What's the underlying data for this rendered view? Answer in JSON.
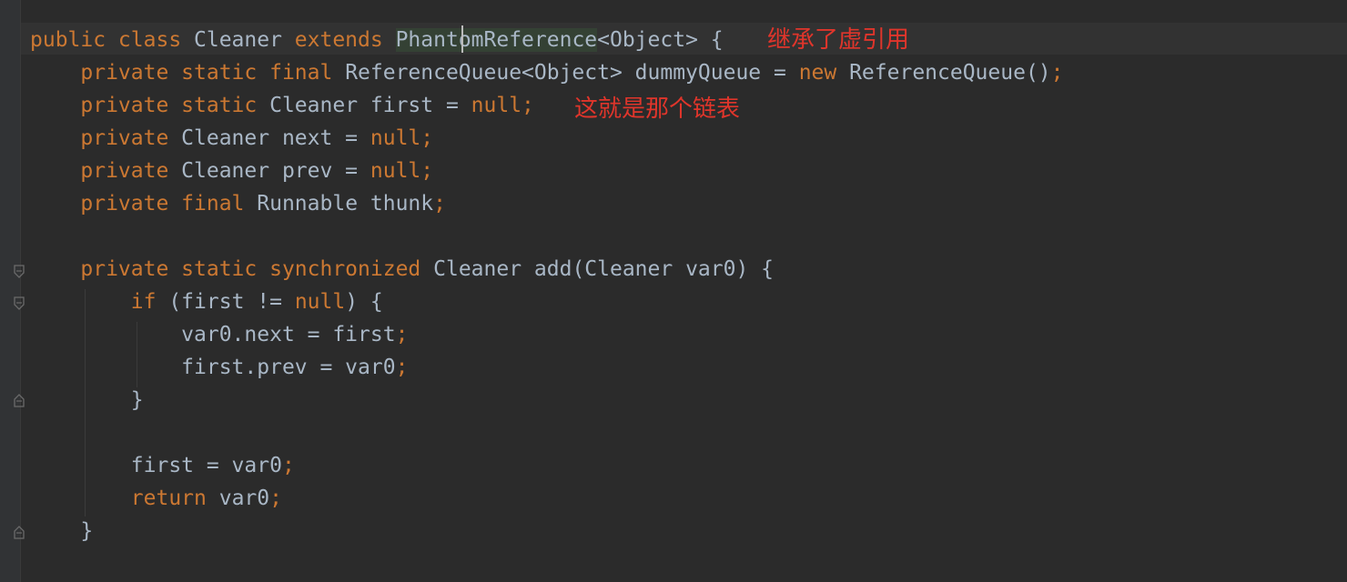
{
  "editor": {
    "lines": [
      [
        {
          "t": "public class ",
          "c": "kw"
        },
        {
          "t": "Cleaner ",
          "c": "pl"
        },
        {
          "t": "extends ",
          "c": "kw"
        },
        {
          "t": "PhantomReference",
          "c": "pl",
          "hl": true
        },
        {
          "t": "<Object> {",
          "c": "pl"
        }
      ],
      [
        {
          "t": "    "
        },
        {
          "t": "private static final ",
          "c": "kw"
        },
        {
          "t": "ReferenceQueue<Object> dummyQueue = ",
          "c": "pl"
        },
        {
          "t": "new ",
          "c": "kw"
        },
        {
          "t": "ReferenceQueue()",
          "c": "pl"
        },
        {
          "t": ";",
          "c": "punc"
        }
      ],
      [
        {
          "t": "    "
        },
        {
          "t": "private static ",
          "c": "kw"
        },
        {
          "t": "Cleaner first = ",
          "c": "pl"
        },
        {
          "t": "null;",
          "c": "kw"
        }
      ],
      [
        {
          "t": "    "
        },
        {
          "t": "private ",
          "c": "kw"
        },
        {
          "t": "Cleaner next = ",
          "c": "pl"
        },
        {
          "t": "null;",
          "c": "kw"
        }
      ],
      [
        {
          "t": "    "
        },
        {
          "t": "private ",
          "c": "kw"
        },
        {
          "t": "Cleaner prev = ",
          "c": "pl"
        },
        {
          "t": "null;",
          "c": "kw"
        }
      ],
      [
        {
          "t": "    "
        },
        {
          "t": "private final ",
          "c": "kw"
        },
        {
          "t": "Runnable thunk",
          "c": "pl"
        },
        {
          "t": ";",
          "c": "punc"
        }
      ],
      [],
      [
        {
          "t": "    "
        },
        {
          "t": "private static synchronized ",
          "c": "kw"
        },
        {
          "t": "Cleaner add(Cleaner var0) {",
          "c": "pl"
        }
      ],
      [
        {
          "t": "        "
        },
        {
          "t": "if ",
          "c": "kw"
        },
        {
          "t": "(first != ",
          "c": "pl"
        },
        {
          "t": "null",
          "c": "kw"
        },
        {
          "t": ") {",
          "c": "pl"
        }
      ],
      [
        {
          "t": "            "
        },
        {
          "t": "var0.next = first",
          "c": "pl"
        },
        {
          "t": ";",
          "c": "punc"
        }
      ],
      [
        {
          "t": "            "
        },
        {
          "t": "first.prev = var0",
          "c": "pl"
        },
        {
          "t": ";",
          "c": "punc"
        }
      ],
      [
        {
          "t": "        "
        },
        {
          "t": "}",
          "c": "pl"
        }
      ],
      [],
      [
        {
          "t": "        "
        },
        {
          "t": "first = var0",
          "c": "pl"
        },
        {
          "t": ";",
          "c": "punc"
        }
      ],
      [
        {
          "t": "        "
        },
        {
          "t": "return ",
          "c": "kw"
        },
        {
          "t": "var0",
          "c": "pl"
        },
        {
          "t": ";",
          "c": "punc"
        }
      ],
      [
        {
          "t": "    "
        },
        {
          "t": "}",
          "c": "pl"
        }
      ]
    ]
  },
  "annotations": {
    "inherits_phantom": "继承了虚引用",
    "linked_list": "这就是那个链表"
  },
  "colors": {
    "background": "#2b2b2b",
    "keyword": "#cc7832",
    "plain": "#a9b7c6",
    "annotation": "#e0352b",
    "usage_highlight": "#344134"
  }
}
